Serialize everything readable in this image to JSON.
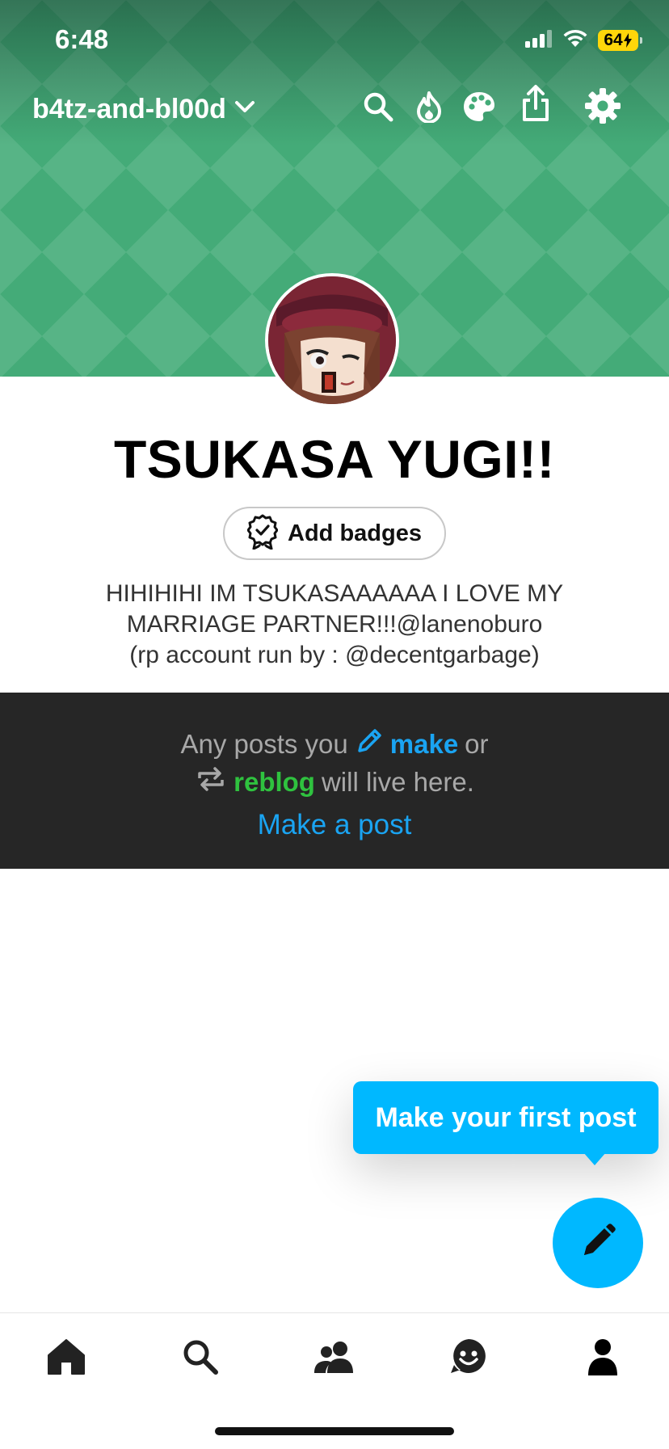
{
  "status_bar": {
    "time": "6:48",
    "battery": "64",
    "icons": [
      "cellular-signal-icon",
      "wifi-icon",
      "battery-charging-icon"
    ]
  },
  "header": {
    "blog_name": "b4tz-and-bl00d",
    "accent_color": "#44ab78",
    "icons": [
      "search-icon",
      "flame-icon",
      "palette-icon",
      "share-icon",
      "gear-icon"
    ]
  },
  "profile": {
    "title": "TSUKASA YUGI!!",
    "badge_button_label": "Add badges",
    "bio_lines": [
      "HIHIHIHI IM TSUKASAAAAAA I LOVE MY",
      "MARRIAGE PARTNER!!!@lanenoburo",
      "(rp account run by : @decentgarbage)"
    ]
  },
  "empty_state": {
    "line1_prefix": "Any posts you",
    "make_word": "make",
    "line1_suffix": "or",
    "reblog_word": "reblog",
    "line2_suffix": "will live here.",
    "link_label": "Make a post",
    "link_color": "#1aa4f2",
    "reblog_color": "#2fc23f"
  },
  "tooltip": {
    "text": "Make your first post",
    "color": "#00b8ff"
  },
  "tabbar": {
    "tabs": [
      "home-icon",
      "search-icon",
      "community-icon",
      "activity-icon",
      "account-icon"
    ],
    "active": "account-icon"
  }
}
